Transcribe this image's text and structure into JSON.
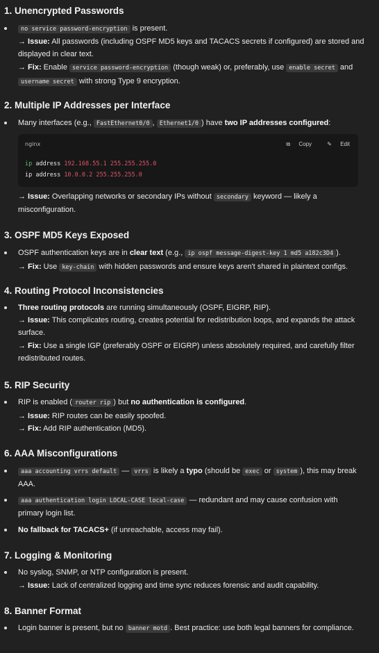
{
  "sections": [
    {
      "title": "1. Unencrypted Passwords"
    },
    {
      "title": "2. Multiple IP Addresses per Interface"
    },
    {
      "title": "3. OSPF MD5 Keys Exposed"
    },
    {
      "title": "4. Routing Protocol Inconsistencies"
    },
    {
      "title": "5. RIP Security"
    },
    {
      "title": "6. AAA Misconfigurations"
    },
    {
      "title": "7. Logging & Monitoring"
    },
    {
      "title": "8. Banner Format"
    }
  ],
  "s1": {
    "code1": "no service password-encryption",
    "t1": " is present.",
    "issue_label": "→ Issue:",
    "issue_text": " All passwords (including OSPF MD5 keys and TACACS secrets if configured) are stored and displayed in clear text.",
    "fix_label": "→ Fix:",
    "fix_t1": " Enable ",
    "fix_code1": "service password-encryption",
    "fix_t2": " (though weak) or, preferably, use ",
    "fix_code2": "enable secret",
    "fix_t3": " and",
    "fix_code3": "username secret",
    "fix_t4": " with strong Type 9 encryption."
  },
  "s2": {
    "t1": "Many interfaces (e.g., ",
    "code1": "FastEthernet0/0",
    "t2": ", ",
    "code2": "Ethernet1/0",
    "t3": ") have ",
    "bold1": "two IP addresses configured",
    "t4": ":",
    "codeblock": {
      "lang": "nginx",
      "copy": "Copy",
      "edit": "Edit",
      "lines": [
        {
          "kw": "ip",
          "rest": " address ",
          "val": "192.168.55.1 255.255.255.0"
        },
        {
          "kw": "ip",
          "rest": " address ",
          "val": "10.0.0.2 255.255.255.0"
        }
      ]
    },
    "issue_label": "→ Issue:",
    "issue_t1": " Overlapping networks or secondary IPs without ",
    "issue_code": "secondary",
    "issue_t2": " keyword — likely a",
    "issue_t3": "misconfiguration."
  },
  "s3": {
    "t1": "OSPF authentication keys are in ",
    "bold1": "clear text",
    "t2": " (e.g., ",
    "code1": "ip ospf message-digest-key 1 md5 a182c3D4",
    "t3": ").",
    "fix_label": "→ Fix:",
    "fix_t1": " Use ",
    "fix_code": "key-chain",
    "fix_t2": " with hidden passwords and ensure keys aren't shared in plaintext configs."
  },
  "s4": {
    "bold1": "Three routing protocols",
    "t1": " are running simultaneously (OSPF, EIGRP, RIP).",
    "issue_label": "→ Issue:",
    "issue_t1": " This complicates routing, creates potential for redistribution loops, and expands the attack",
    "issue_t2": "surface.",
    "fix_label": "→ Fix:",
    "fix_t1": " Use a single IGP (preferably OSPF or EIGRP) unless absolutely required, and carefully filter",
    "fix_t2": "redistributed routes."
  },
  "s5": {
    "t1": "RIP is enabled (",
    "code1": "router rip",
    "t2": ") but ",
    "bold1": "no authentication is configured",
    "t3": ".",
    "issue_label": "→ Issue:",
    "issue_t1": " RIP routes can be easily spoofed.",
    "fix_label": "→ Fix:",
    "fix_t1": " Add RIP authentication (MD5)."
  },
  "s6": {
    "b1_code1": "aaa accounting vrrs default",
    "b1_t1": " — ",
    "b1_code2": "vrrs",
    "b1_t2": " is likely a ",
    "b1_bold": "typo",
    "b1_t3": " (should be ",
    "b1_code3": "exec",
    "b1_t4": " or ",
    "b1_code4": "system",
    "b1_t5": "), this may break",
    "b1_t6": "AAA.",
    "b2_code1": "aaa authentication login LOCAL-CASE local-case",
    "b2_t1": " — redundant and may cause confusion with",
    "b2_t2": "primary login list.",
    "b3_bold": "No fallback for TACACS+",
    "b3_t1": " (if unreachable, access may fail)."
  },
  "s7": {
    "t1": "No syslog, SNMP, or NTP configuration is present.",
    "issue_label": "→ Issue:",
    "issue_t1": " Lack of centralized logging and time sync reduces forensic and audit capability."
  },
  "s8": {
    "t1": "Login banner is present, but no ",
    "code1": "banner motd",
    "t2": ". Best practice: use both legal banners for compliance."
  }
}
